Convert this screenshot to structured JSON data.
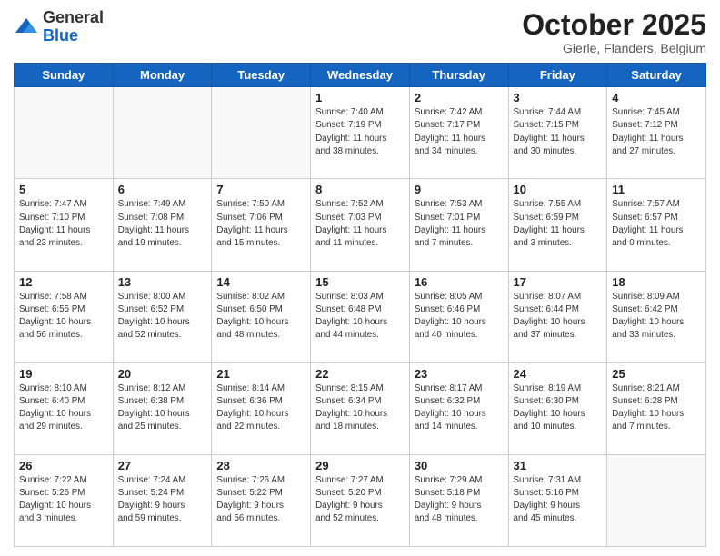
{
  "header": {
    "logo_general": "General",
    "logo_blue": "Blue",
    "month_title": "October 2025",
    "location": "Gierle, Flanders, Belgium"
  },
  "days_of_week": [
    "Sunday",
    "Monday",
    "Tuesday",
    "Wednesday",
    "Thursday",
    "Friday",
    "Saturday"
  ],
  "weeks": [
    [
      {
        "day": "",
        "info": ""
      },
      {
        "day": "",
        "info": ""
      },
      {
        "day": "",
        "info": ""
      },
      {
        "day": "1",
        "info": "Sunrise: 7:40 AM\nSunset: 7:19 PM\nDaylight: 11 hours\nand 38 minutes."
      },
      {
        "day": "2",
        "info": "Sunrise: 7:42 AM\nSunset: 7:17 PM\nDaylight: 11 hours\nand 34 minutes."
      },
      {
        "day": "3",
        "info": "Sunrise: 7:44 AM\nSunset: 7:15 PM\nDaylight: 11 hours\nand 30 minutes."
      },
      {
        "day": "4",
        "info": "Sunrise: 7:45 AM\nSunset: 7:12 PM\nDaylight: 11 hours\nand 27 minutes."
      }
    ],
    [
      {
        "day": "5",
        "info": "Sunrise: 7:47 AM\nSunset: 7:10 PM\nDaylight: 11 hours\nand 23 minutes."
      },
      {
        "day": "6",
        "info": "Sunrise: 7:49 AM\nSunset: 7:08 PM\nDaylight: 11 hours\nand 19 minutes."
      },
      {
        "day": "7",
        "info": "Sunrise: 7:50 AM\nSunset: 7:06 PM\nDaylight: 11 hours\nand 15 minutes."
      },
      {
        "day": "8",
        "info": "Sunrise: 7:52 AM\nSunset: 7:03 PM\nDaylight: 11 hours\nand 11 minutes."
      },
      {
        "day": "9",
        "info": "Sunrise: 7:53 AM\nSunset: 7:01 PM\nDaylight: 11 hours\nand 7 minutes."
      },
      {
        "day": "10",
        "info": "Sunrise: 7:55 AM\nSunset: 6:59 PM\nDaylight: 11 hours\nand 3 minutes."
      },
      {
        "day": "11",
        "info": "Sunrise: 7:57 AM\nSunset: 6:57 PM\nDaylight: 11 hours\nand 0 minutes."
      }
    ],
    [
      {
        "day": "12",
        "info": "Sunrise: 7:58 AM\nSunset: 6:55 PM\nDaylight: 10 hours\nand 56 minutes."
      },
      {
        "day": "13",
        "info": "Sunrise: 8:00 AM\nSunset: 6:52 PM\nDaylight: 10 hours\nand 52 minutes."
      },
      {
        "day": "14",
        "info": "Sunrise: 8:02 AM\nSunset: 6:50 PM\nDaylight: 10 hours\nand 48 minutes."
      },
      {
        "day": "15",
        "info": "Sunrise: 8:03 AM\nSunset: 6:48 PM\nDaylight: 10 hours\nand 44 minutes."
      },
      {
        "day": "16",
        "info": "Sunrise: 8:05 AM\nSunset: 6:46 PM\nDaylight: 10 hours\nand 40 minutes."
      },
      {
        "day": "17",
        "info": "Sunrise: 8:07 AM\nSunset: 6:44 PM\nDaylight: 10 hours\nand 37 minutes."
      },
      {
        "day": "18",
        "info": "Sunrise: 8:09 AM\nSunset: 6:42 PM\nDaylight: 10 hours\nand 33 minutes."
      }
    ],
    [
      {
        "day": "19",
        "info": "Sunrise: 8:10 AM\nSunset: 6:40 PM\nDaylight: 10 hours\nand 29 minutes."
      },
      {
        "day": "20",
        "info": "Sunrise: 8:12 AM\nSunset: 6:38 PM\nDaylight: 10 hours\nand 25 minutes."
      },
      {
        "day": "21",
        "info": "Sunrise: 8:14 AM\nSunset: 6:36 PM\nDaylight: 10 hours\nand 22 minutes."
      },
      {
        "day": "22",
        "info": "Sunrise: 8:15 AM\nSunset: 6:34 PM\nDaylight: 10 hours\nand 18 minutes."
      },
      {
        "day": "23",
        "info": "Sunrise: 8:17 AM\nSunset: 6:32 PM\nDaylight: 10 hours\nand 14 minutes."
      },
      {
        "day": "24",
        "info": "Sunrise: 8:19 AM\nSunset: 6:30 PM\nDaylight: 10 hours\nand 10 minutes."
      },
      {
        "day": "25",
        "info": "Sunrise: 8:21 AM\nSunset: 6:28 PM\nDaylight: 10 hours\nand 7 minutes."
      }
    ],
    [
      {
        "day": "26",
        "info": "Sunrise: 7:22 AM\nSunset: 5:26 PM\nDaylight: 10 hours\nand 3 minutes."
      },
      {
        "day": "27",
        "info": "Sunrise: 7:24 AM\nSunset: 5:24 PM\nDaylight: 9 hours\nand 59 minutes."
      },
      {
        "day": "28",
        "info": "Sunrise: 7:26 AM\nSunset: 5:22 PM\nDaylight: 9 hours\nand 56 minutes."
      },
      {
        "day": "29",
        "info": "Sunrise: 7:27 AM\nSunset: 5:20 PM\nDaylight: 9 hours\nand 52 minutes."
      },
      {
        "day": "30",
        "info": "Sunrise: 7:29 AM\nSunset: 5:18 PM\nDaylight: 9 hours\nand 48 minutes."
      },
      {
        "day": "31",
        "info": "Sunrise: 7:31 AM\nSunset: 5:16 PM\nDaylight: 9 hours\nand 45 minutes."
      },
      {
        "day": "",
        "info": ""
      }
    ]
  ]
}
